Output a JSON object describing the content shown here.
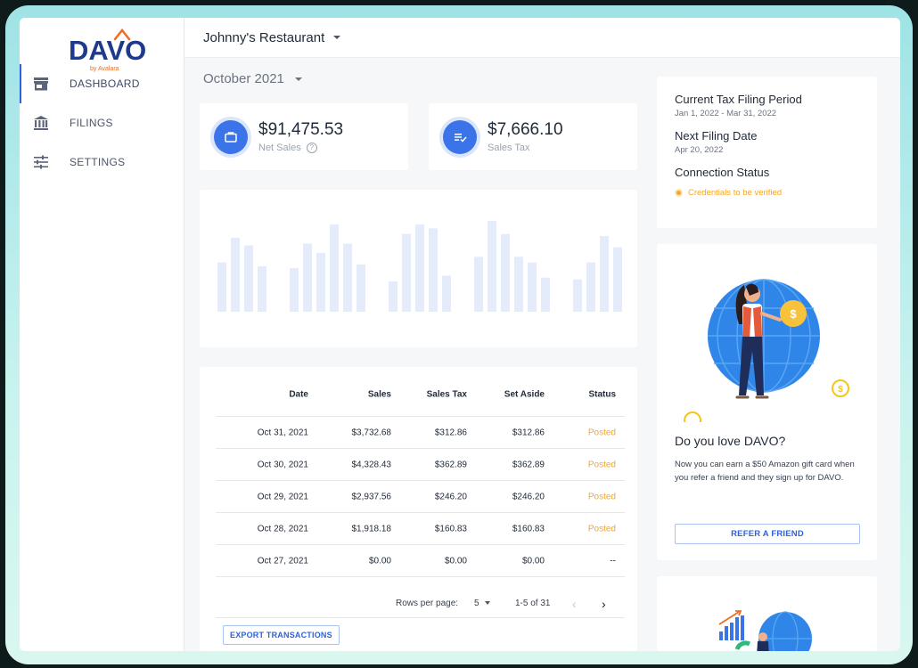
{
  "brand": {
    "name": "DAVO",
    "sub": "by Avalara",
    "primary": "#1f3a8a",
    "accent": "#2e62d9",
    "orange": "#f26b21"
  },
  "sidebar": {
    "items": [
      {
        "label": "DASHBOARD",
        "icon": "store-icon",
        "active": true
      },
      {
        "label": "FILINGS",
        "icon": "bank-icon",
        "active": false
      },
      {
        "label": "SETTINGS",
        "icon": "sliders-icon",
        "active": false
      }
    ]
  },
  "header": {
    "restaurant": "Johnny's Restaurant"
  },
  "period": {
    "month": "October 2021"
  },
  "stats": {
    "net_sales": {
      "value": "$91,475.53",
      "label": "Net Sales",
      "icon": "briefcase-icon"
    },
    "sales_tax": {
      "value": "$7,666.10",
      "label": "Sales Tax",
      "icon": "tax-list-icon"
    }
  },
  "chart_data": {
    "type": "bar",
    "groups": [
      [
        52,
        78,
        70,
        48
      ],
      [
        46,
        72,
        62,
        92,
        72,
        50
      ],
      [
        32,
        82,
        92,
        88,
        38
      ],
      [
        58,
        96,
        82,
        58,
        52,
        36
      ],
      [
        34,
        52,
        80,
        68
      ]
    ],
    "ylim": [
      0,
      110
    ],
    "color": "#e4ebfb"
  },
  "table": {
    "headers": {
      "date": "Date",
      "sales": "Sales",
      "tax": "Sales Tax",
      "aside": "Set Aside",
      "status": "Status"
    },
    "rows": [
      {
        "date": "Oct 31, 2021",
        "sales": "$3,732.68",
        "tax": "$312.86",
        "aside": "$312.86",
        "status": "Posted"
      },
      {
        "date": "Oct 30, 2021",
        "sales": "$4,328.43",
        "tax": "$362.89",
        "aside": "$362.89",
        "status": "Posted"
      },
      {
        "date": "Oct 29, 2021",
        "sales": "$2,937.56",
        "tax": "$246.20",
        "aside": "$246.20",
        "status": "Posted"
      },
      {
        "date": "Oct 28, 2021",
        "sales": "$1,918.18",
        "tax": "$160.83",
        "aside": "$160.83",
        "status": "Posted"
      },
      {
        "date": "Oct 27, 2021",
        "sales": "$0.00",
        "tax": "$0.00",
        "aside": "$0.00",
        "status": "--"
      }
    ],
    "pager": {
      "rows_label": "Rows per page:",
      "rows_value": "5",
      "range": "1-5 of 31",
      "prev": "‹",
      "next": "›"
    },
    "export_label": "EXPORT TRANSACTIONS"
  },
  "filing": {
    "current_title": "Current Tax Filing Period",
    "current_value": "Jan 1, 2022 - Mar 31, 2022",
    "next_title": "Next Filing Date",
    "next_value": "Apr 20, 2022",
    "conn_title": "Connection Status",
    "conn_value": "Credentials to be verified"
  },
  "promo": {
    "title": "Do you love DAVO?",
    "text": "Now you can earn a $50 Amazon gift card when you refer a friend and they sign up for DAVO.",
    "button": "REFER A FRIEND"
  },
  "colors": {
    "posted": "#f5a623",
    "bar": "#e4ebfb"
  }
}
